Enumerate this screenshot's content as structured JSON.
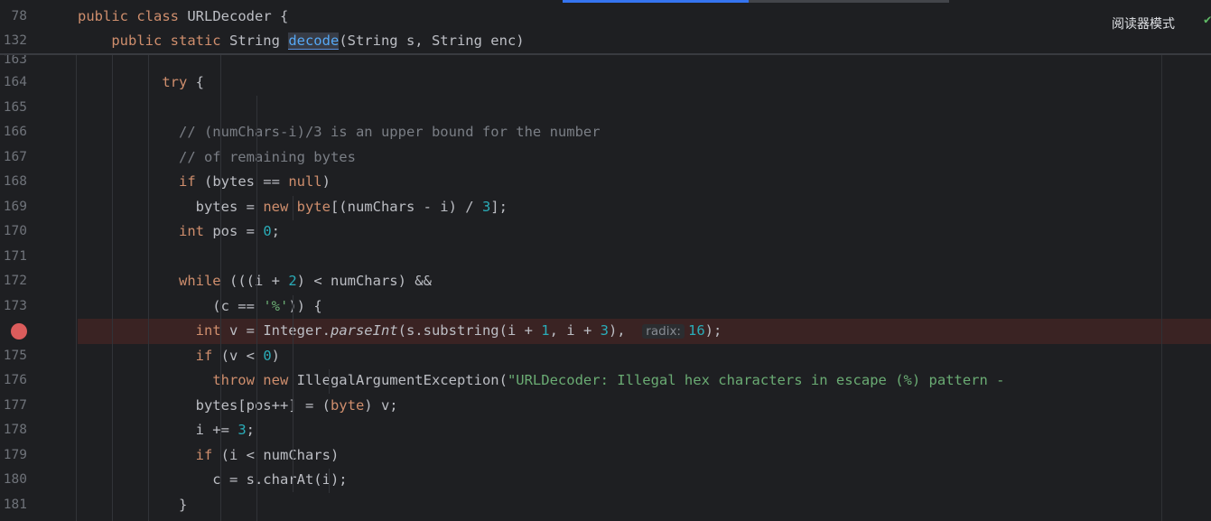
{
  "reader_mode": "阅读器模式",
  "check_icon": "✔",
  "sticky": [
    {
      "ln": "78",
      "segs": [
        [
          "kw",
          "public class "
        ],
        [
          "",
          "URLDecoder {"
        ]
      ]
    },
    {
      "ln": "132",
      "segs": [
        [
          "",
          "    "
        ],
        [
          "kw",
          "public static "
        ],
        [
          "",
          "String "
        ],
        [
          "fn",
          "decode"
        ],
        [
          "",
          "(String s, String enc)"
        ]
      ]
    }
  ],
  "lines": [
    {
      "ln": "163",
      "segs": []
    },
    {
      "ln": "164",
      "segs": [
        [
          "",
          "          "
        ],
        [
          "kw",
          "try"
        ],
        [
          "",
          " {"
        ]
      ]
    },
    {
      "ln": "165",
      "segs": []
    },
    {
      "ln": "166",
      "segs": [
        [
          "",
          "            "
        ],
        [
          "cmt",
          "// (numChars-i)/3 is an upper bound for the number"
        ]
      ]
    },
    {
      "ln": "167",
      "segs": [
        [
          "",
          "            "
        ],
        [
          "cmt",
          "// of remaining bytes"
        ]
      ]
    },
    {
      "ln": "168",
      "segs": [
        [
          "",
          "            "
        ],
        [
          "kw",
          "if"
        ],
        [
          "",
          " (bytes == "
        ],
        [
          "kw",
          "null"
        ],
        [
          "",
          ")"
        ]
      ]
    },
    {
      "ln": "169",
      "segs": [
        [
          "",
          "              bytes = "
        ],
        [
          "kw",
          "new byte"
        ],
        [
          "",
          "[(numChars - i) / "
        ],
        [
          "num",
          "3"
        ],
        [
          "",
          "];"
        ]
      ]
    },
    {
      "ln": "170",
      "segs": [
        [
          "",
          "            "
        ],
        [
          "kw",
          "int"
        ],
        [
          "",
          " pos = "
        ],
        [
          "num",
          "0"
        ],
        [
          "",
          ";"
        ]
      ]
    },
    {
      "ln": "171",
      "segs": []
    },
    {
      "ln": "172",
      "segs": [
        [
          "",
          "            "
        ],
        [
          "kw",
          "while"
        ],
        [
          "",
          " (((i + "
        ],
        [
          "num",
          "2"
        ],
        [
          "",
          ") < numChars) &&"
        ]
      ]
    },
    {
      "ln": "173",
      "segs": [
        [
          "",
          "                (c == "
        ],
        [
          "str",
          "'%'"
        ],
        [
          "",
          "))"
        ],
        [
          "",
          " {"
        ]
      ]
    },
    {
      "ln": "",
      "bp": true,
      "segs": [
        [
          "",
          "              "
        ],
        [
          "kw",
          "int"
        ],
        [
          "",
          " v = Integer."
        ],
        [
          "ital",
          "parseInt"
        ],
        [
          "",
          "(s.substring(i + "
        ],
        [
          "num",
          "1"
        ],
        [
          "",
          ", i + "
        ],
        [
          "num",
          "3"
        ],
        [
          "",
          "),  "
        ],
        [
          "hint",
          "radix:"
        ],
        [
          "num",
          "16"
        ],
        [
          "",
          ");"
        ]
      ]
    },
    {
      "ln": "175",
      "segs": [
        [
          "",
          "              "
        ],
        [
          "kw",
          "if"
        ],
        [
          "",
          " (v < "
        ],
        [
          "num",
          "0"
        ],
        [
          "",
          ")"
        ]
      ]
    },
    {
      "ln": "176",
      "segs": [
        [
          "",
          "                "
        ],
        [
          "kw",
          "throw new "
        ],
        [
          "",
          "IllegalArgumentException("
        ],
        [
          "str",
          "\"URLDecoder: Illegal hex characters in escape (%) pattern -"
        ]
      ]
    },
    {
      "ln": "177",
      "segs": [
        [
          "",
          "              bytes[pos++] = ("
        ],
        [
          "kw",
          "byte"
        ],
        [
          "",
          ") v;"
        ]
      ]
    },
    {
      "ln": "178",
      "segs": [
        [
          "",
          "              i += "
        ],
        [
          "num",
          "3"
        ],
        [
          "",
          ";"
        ]
      ]
    },
    {
      "ln": "179",
      "segs": [
        [
          "",
          "              "
        ],
        [
          "kw",
          "if"
        ],
        [
          "",
          " (i < numChars)"
        ]
      ]
    },
    {
      "ln": "180",
      "segs": [
        [
          "",
          "                c = s.charAt(i);"
        ]
      ]
    },
    {
      "ln": "181",
      "segs": [
        [
          "",
          "            }"
        ]
      ]
    }
  ]
}
